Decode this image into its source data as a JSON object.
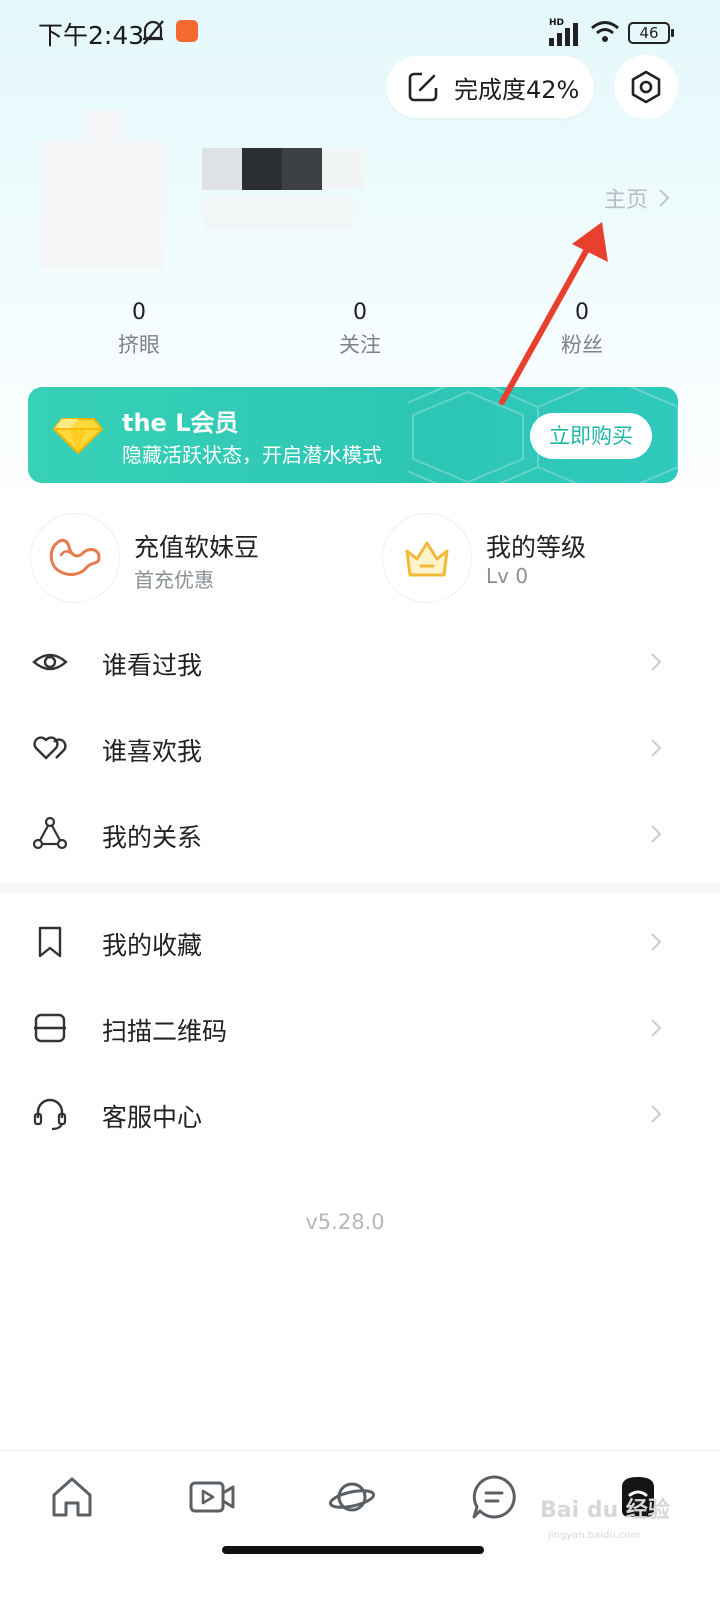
{
  "status_bar": {
    "time": "下午2:43",
    "network": "HD",
    "battery": "46"
  },
  "header": {
    "completion_label": "完成度42%",
    "home_link": "主页"
  },
  "stats": [
    {
      "value": "0",
      "label": "挤眼"
    },
    {
      "value": "0",
      "label": "关注"
    },
    {
      "value": "0",
      "label": "粉丝"
    }
  ],
  "vip": {
    "title": "the L会员",
    "subtitle": "隐藏活跃状态，开启潜水模式",
    "buy_label": "立即购买"
  },
  "quick": {
    "recharge_title": "充值软妹豆",
    "recharge_sub": "首充优惠",
    "level_title": "我的等级",
    "level_sub": "Lv 0"
  },
  "menu": [
    {
      "label": "谁看过我",
      "icon": "eye-icon"
    },
    {
      "label": "谁喜欢我",
      "icon": "hearts-icon"
    },
    {
      "label": "我的关系",
      "icon": "relation-icon"
    },
    {
      "label": "我的收藏",
      "icon": "bookmark-icon"
    },
    {
      "label": "扫描二维码",
      "icon": "scan-icon"
    },
    {
      "label": "客服中心",
      "icon": "headset-icon"
    }
  ],
  "version": "v5.28.0",
  "bottom_nav": [
    "home-icon",
    "video-icon",
    "planet-icon",
    "message-icon",
    "profile-icon"
  ],
  "watermark": {
    "main": "Bai du 经验",
    "sub": "jingyan.baidu.com"
  },
  "colors": {
    "accent": "#2dc6b5",
    "annotation": "#e8402f"
  }
}
